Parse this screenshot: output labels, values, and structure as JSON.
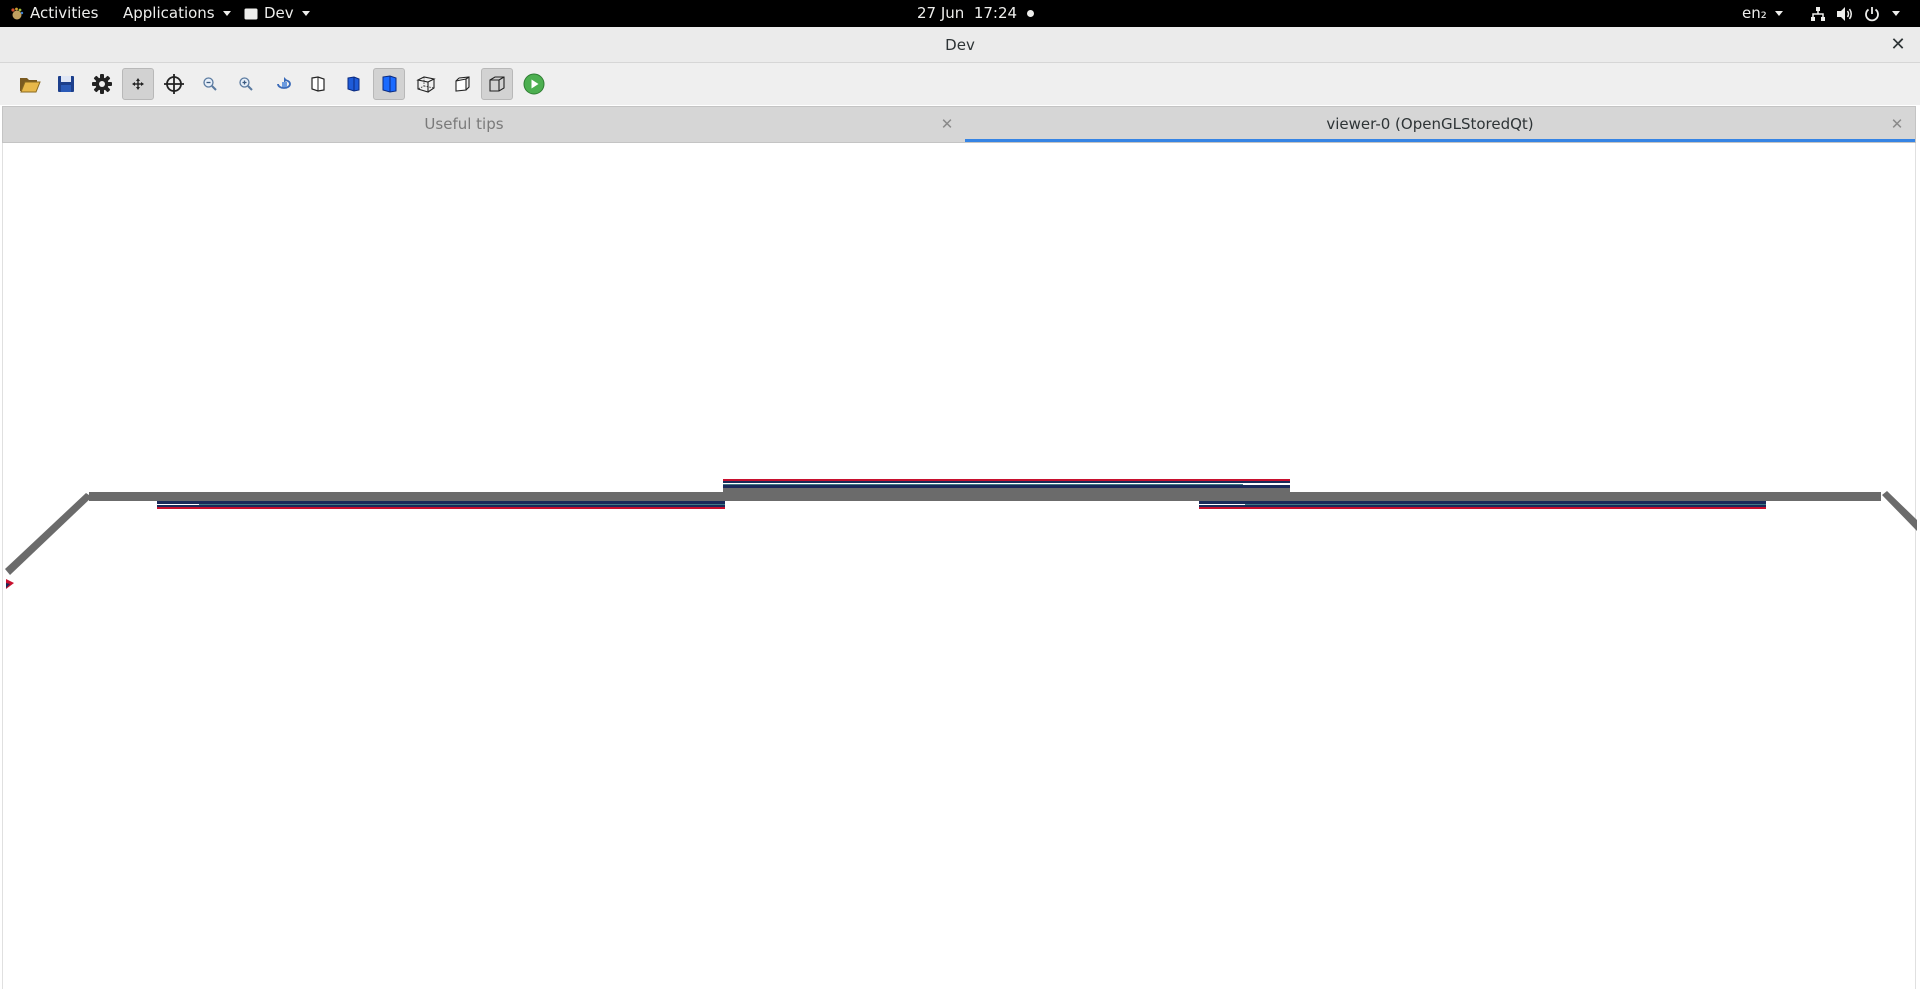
{
  "topbar": {
    "activities": "Activities",
    "applications": "Applications",
    "app_menu": "Dev",
    "clock": "27 Jun  17:24",
    "input_source": "en₂"
  },
  "window": {
    "title": "Dev",
    "close_glyph": "✕"
  },
  "toolbar": {
    "buttons": [
      {
        "name": "open-icon",
        "pressed": false
      },
      {
        "name": "save-icon",
        "pressed": false
      },
      {
        "name": "settings-icon",
        "pressed": false
      },
      {
        "name": "move-icon",
        "pressed": true
      },
      {
        "name": "pick-icon",
        "pressed": false
      },
      {
        "name": "zoom-out-icon",
        "pressed": false
      },
      {
        "name": "zoom-in-icon",
        "pressed": false
      },
      {
        "name": "rotate-icon",
        "pressed": false
      },
      {
        "name": "hidden-line-icon",
        "pressed": false
      },
      {
        "name": "solid-icon",
        "pressed": false
      },
      {
        "name": "surface-icon",
        "pressed": true
      },
      {
        "name": "wireframe-icon",
        "pressed": false
      },
      {
        "name": "perspective-icon",
        "pressed": false
      },
      {
        "name": "orthographic-icon",
        "pressed": true
      },
      {
        "name": "run-icon",
        "pressed": false
      }
    ]
  },
  "tabs": [
    {
      "label": "Useful tips",
      "close_glyph": "✕"
    },
    {
      "label": "viewer-0 (OpenGLStoredQt)",
      "close_glyph": "✕"
    }
  ],
  "colors": {
    "accent": "#3584e4",
    "geometry_gray": "#6b6b6b",
    "detector_red": "#c8102e",
    "detector_navy": "#1a2a5a",
    "detector_teal": "#3f7a86",
    "run_green": "#4caf50"
  }
}
